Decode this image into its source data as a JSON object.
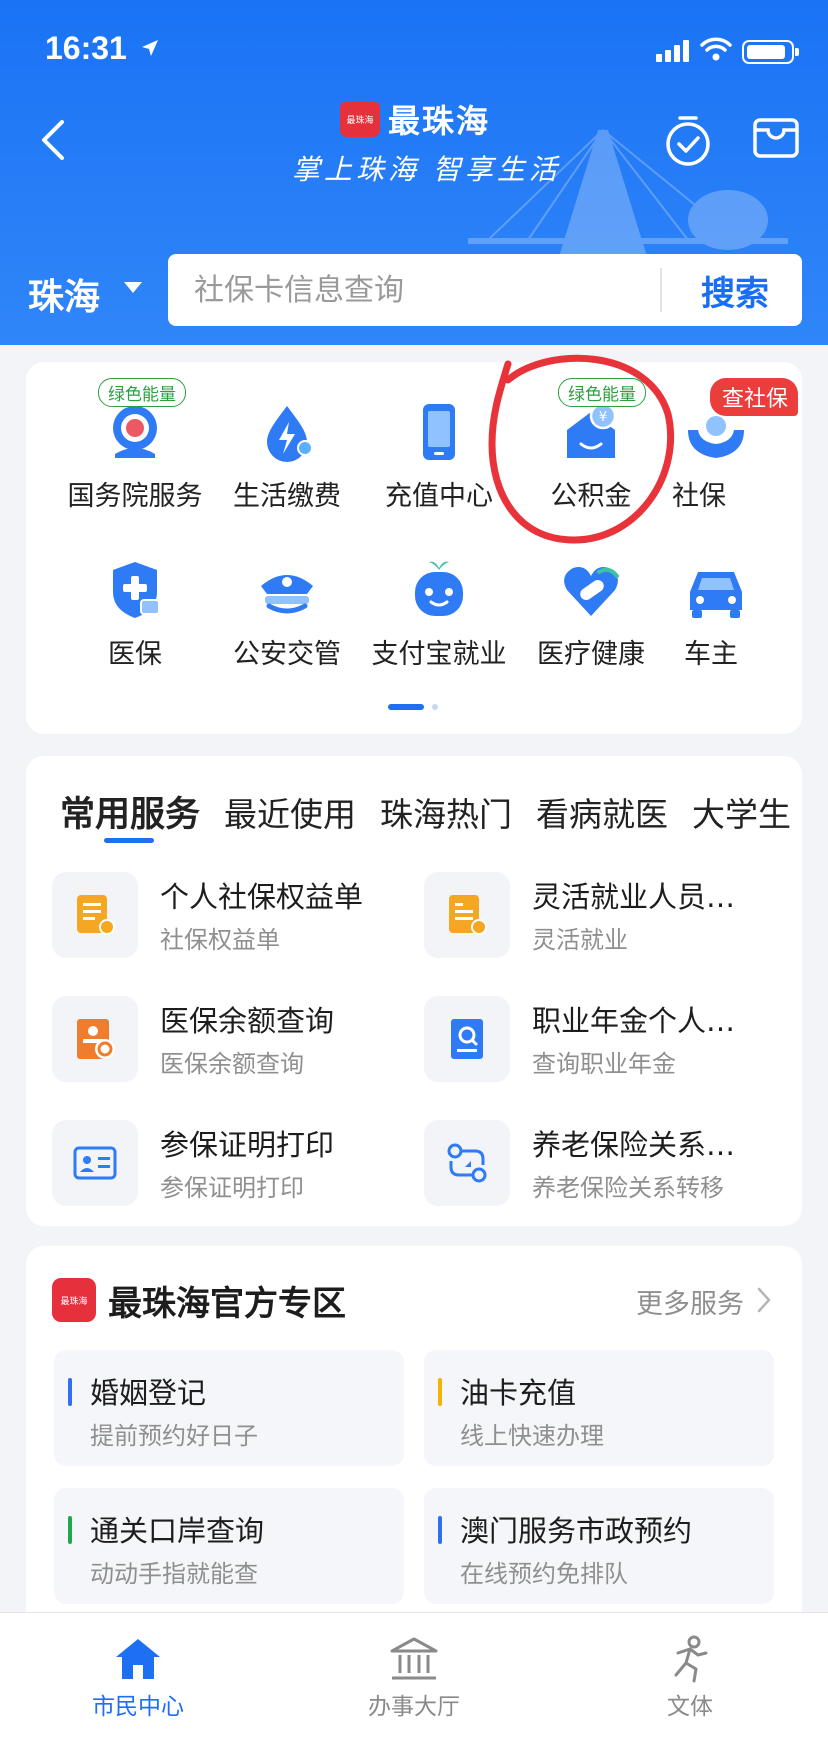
{
  "status_bar": {
    "time": "16:31"
  },
  "header": {
    "brand_name": "最珠海",
    "brand_logo_text": "最珠海",
    "slogan": "掌上珠海  智享生活",
    "city": "珠海",
    "search_placeholder": "社保卡信息查询",
    "search_button": "搜索"
  },
  "quick_grid": {
    "items": [
      {
        "label": "国务院服务",
        "tag": "绿色能量",
        "icon": "state-council-icon"
      },
      {
        "label": "生活缴费",
        "icon": "bill-payment-icon"
      },
      {
        "label": "充值中心",
        "icon": "phone-recharge-icon"
      },
      {
        "label": "公积金",
        "tag": "绿色能量",
        "icon": "housing-fund-icon"
      },
      {
        "label": "社保",
        "tag": "查社保",
        "icon": "social-security-icon"
      },
      {
        "label": "医保",
        "icon": "medical-insurance-icon"
      },
      {
        "label": "公安交管",
        "icon": "police-cap-icon"
      },
      {
        "label": "支付宝就业",
        "icon": "employment-mascot-icon"
      },
      {
        "label": "医疗健康",
        "icon": "health-heart-icon"
      },
      {
        "label": "车主",
        "icon": "car-icon"
      }
    ]
  },
  "services": {
    "tabs": [
      "常用服务",
      "最近使用",
      "珠海热门",
      "看病就医",
      "大学生"
    ],
    "items": [
      {
        "title": "个人社保权益单",
        "subtitle": "社保权益单",
        "icon": "document-orange-icon"
      },
      {
        "title": "灵活就业人员…",
        "subtitle": "灵活就业",
        "icon": "document-orange-icon"
      },
      {
        "title": "医保余额查询",
        "subtitle": "医保余额查询",
        "icon": "balance-query-icon"
      },
      {
        "title": "职业年金个人…",
        "subtitle": "查询职业年金",
        "icon": "pension-search-icon"
      },
      {
        "title": "参保证明打印",
        "subtitle": "参保证明打印",
        "icon": "id-card-icon"
      },
      {
        "title": "养老保险关系…",
        "subtitle": "养老保险关系转移",
        "icon": "transfer-route-icon"
      }
    ]
  },
  "zone": {
    "logo_text": "最珠海",
    "title": "最珠海官方专区",
    "more": "更多服务",
    "items": [
      {
        "title": "婚姻登记",
        "subtitle": "提前预约好日子",
        "accent": "#2f6ff0"
      },
      {
        "title": "油卡充值",
        "subtitle": "线上快速办理",
        "accent": "#f3b300"
      },
      {
        "title": "通关口岸查询",
        "subtitle": "动动手指就能查",
        "accent": "#22a84b"
      },
      {
        "title": "澳门服务市政预约",
        "subtitle": "在线预约免排队",
        "accent": "#2f6ff0"
      }
    ]
  },
  "bottom_nav": [
    {
      "label": "市民中心",
      "active": true,
      "icon": "home-icon"
    },
    {
      "label": "办事大厅",
      "active": false,
      "icon": "government-hall-icon"
    },
    {
      "label": "文体",
      "active": false,
      "icon": "running-person-icon"
    }
  ],
  "colors": {
    "primary": "#1a73f5",
    "tag_green": "#2e9f3e",
    "tag_red": "#ea3d3c",
    "annotation_red": "#e8333a",
    "orange_icon": "#f5a623"
  }
}
